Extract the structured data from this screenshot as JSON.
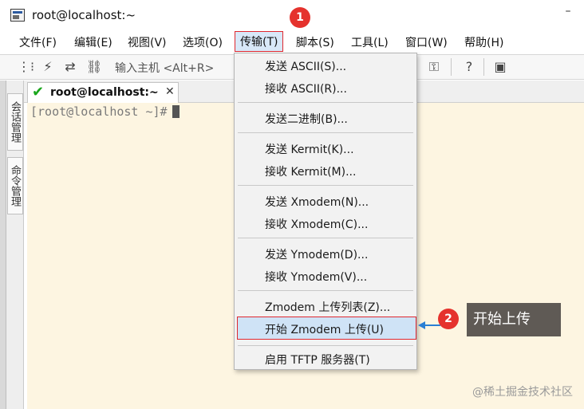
{
  "window": {
    "title": "root@localhost:~",
    "minimize_glyph": "–"
  },
  "menubar": {
    "items": [
      "文件(F)",
      "编辑(E)",
      "视图(V)",
      "选项(O)",
      "传输(T)",
      "脚本(S)",
      "工具(L)",
      "窗口(W)",
      "帮助(H)"
    ]
  },
  "toolbar": {
    "host_placeholder": "输入主机 <Alt+R>"
  },
  "sidebar": {
    "tabs": [
      "会话管理",
      "命令管理"
    ]
  },
  "tabs": {
    "session": "root@localhost:~",
    "close_glyph": "✕",
    "check_glyph": "✔"
  },
  "terminal": {
    "prompt": "[root@localhost ~]#"
  },
  "transfer_menu": {
    "items": [
      "发送 ASCII(S)...",
      "接收 ASCII(R)...",
      "发送二进制(B)...",
      "发送 Kermit(K)...",
      "接收 Kermit(M)...",
      "发送 Xmodem(N)...",
      "接收 Xmodem(C)...",
      "发送 Ymodem(D)...",
      "接收 Ymodem(V)...",
      "Zmodem 上传列表(Z)...",
      "开始 Zmodem 上传(U)",
      "启用 TFTP 服务器(T)"
    ]
  },
  "annotations": {
    "badge1": "1",
    "badge2": "2",
    "callout": "开始上传"
  },
  "watermark": "@稀土掘金技术社区",
  "colors": {
    "highlight_border": "#e0282f",
    "badge": "#e5322d",
    "terminal_bg": "#fdf5e1",
    "arrow": "#2a7fd4"
  }
}
